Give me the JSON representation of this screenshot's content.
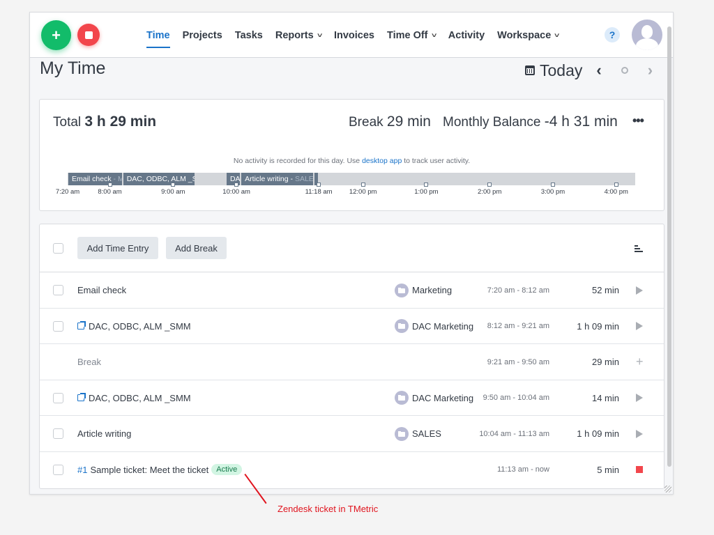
{
  "header": {
    "nav": [
      {
        "label": "Time",
        "active": true,
        "dropdown": false
      },
      {
        "label": "Projects",
        "active": false,
        "dropdown": false
      },
      {
        "label": "Tasks",
        "active": false,
        "dropdown": false
      },
      {
        "label": "Reports",
        "active": false,
        "dropdown": true
      },
      {
        "label": "Invoices",
        "active": false,
        "dropdown": false
      },
      {
        "label": "Time Off",
        "active": false,
        "dropdown": true
      },
      {
        "label": "Activity",
        "active": false,
        "dropdown": false
      },
      {
        "label": "Workspace",
        "active": false,
        "dropdown": true
      }
    ],
    "add_icon": "+",
    "help_label": "?",
    "chevron": "⌄"
  },
  "page": {
    "title": "My Time",
    "date_label": "Today",
    "prev_icon": "‹",
    "next_icon": "›"
  },
  "summary": {
    "total_label": "Total",
    "total_value": "3 h 29 min",
    "break_label": "Break",
    "break_value": "29 min",
    "balance_label": "Monthly Balance",
    "balance_value": "-4 h 31 min",
    "more_label": "•••",
    "no_activity_pre": "No activity is recorded for this day. Use",
    "no_activity_link": "desktop app",
    "no_activity_post": "to track user activity."
  },
  "timeline": {
    "start_hour": 7.333,
    "end_hour": 16.3,
    "segments": [
      {
        "label": "Email check",
        "suffix": " - M",
        "start": 7.333,
        "end": 8.2
      },
      {
        "label": "DAC, ODBC, ALM _S",
        "suffix": "M",
        "start": 8.2,
        "end": 9.35
      },
      {
        "label": "DA",
        "suffix": "",
        "start": 9.833,
        "end": 10.067
      },
      {
        "label": "Article writing - ",
        "suffix": "SALE",
        "start": 10.067,
        "end": 11.217
      },
      {
        "label": "",
        "suffix": "",
        "start": 11.217,
        "end": 11.3
      }
    ],
    "labels": [
      {
        "text": "7:20 am",
        "hour": 7.333,
        "tick": false
      },
      {
        "text": "8:00 am",
        "hour": 8,
        "tick": true
      },
      {
        "text": "9:00 am",
        "hour": 9,
        "tick": true
      },
      {
        "text": "10:00 am",
        "hour": 10,
        "tick": true
      },
      {
        "text": "11:18 am",
        "hour": 11.3,
        "tick": true
      },
      {
        "text": "12:00 pm",
        "hour": 12,
        "tick": true
      },
      {
        "text": "1:00 pm",
        "hour": 13,
        "tick": true
      },
      {
        "text": "2:00 pm",
        "hour": 14,
        "tick": true
      },
      {
        "text": "3:00 pm",
        "hour": 15,
        "tick": true
      },
      {
        "text": "4:00 pm",
        "hour": 16,
        "tick": true
      }
    ]
  },
  "list": {
    "add_entry_label": "Add Time Entry",
    "add_break_label": "Add Break",
    "entries": [
      {
        "description": "Email check",
        "ticket_id": "",
        "external": false,
        "badge": "",
        "project": "Marketing",
        "range": "7:20 am - 8:12 am",
        "duration": "52 min",
        "action": "play",
        "is_break": false
      },
      {
        "description": "DAC, ODBC, ALM _SMM",
        "ticket_id": "",
        "external": true,
        "badge": "",
        "project": "DAC Marketing",
        "range": "8:12 am - 9:21 am",
        "duration": "1 h 09 min",
        "action": "play",
        "is_break": false
      },
      {
        "description": "Break",
        "ticket_id": "",
        "external": false,
        "badge": "",
        "project": "",
        "range": "9:21 am - 9:50 am",
        "duration": "29 min",
        "action": "plus",
        "is_break": true
      },
      {
        "description": "DAC, ODBC, ALM _SMM",
        "ticket_id": "",
        "external": true,
        "badge": "",
        "project": "DAC Marketing",
        "range": "9:50 am - 10:04 am",
        "duration": "14 min",
        "action": "play",
        "is_break": false
      },
      {
        "description": "Article writing",
        "ticket_id": "",
        "external": false,
        "badge": "",
        "project": "SALES",
        "range": "10:04 am - 11:13 am",
        "duration": "1 h 09 min",
        "action": "play",
        "is_break": false
      },
      {
        "description": "Sample ticket: Meet the ticket",
        "ticket_id": "#1",
        "external": false,
        "badge": "Active",
        "project": "",
        "range": "11:13 am - now",
        "duration": "5 min",
        "action": "stop",
        "is_break": false
      }
    ]
  },
  "annotation": {
    "text": "Zendesk ticket in TMetric",
    "color": "#e0141e"
  },
  "colors": {
    "accent": "#1a73c9",
    "add_button": "#12bc6a",
    "stop_button": "#f2464c",
    "active_badge_bg": "#d2f5e3"
  }
}
